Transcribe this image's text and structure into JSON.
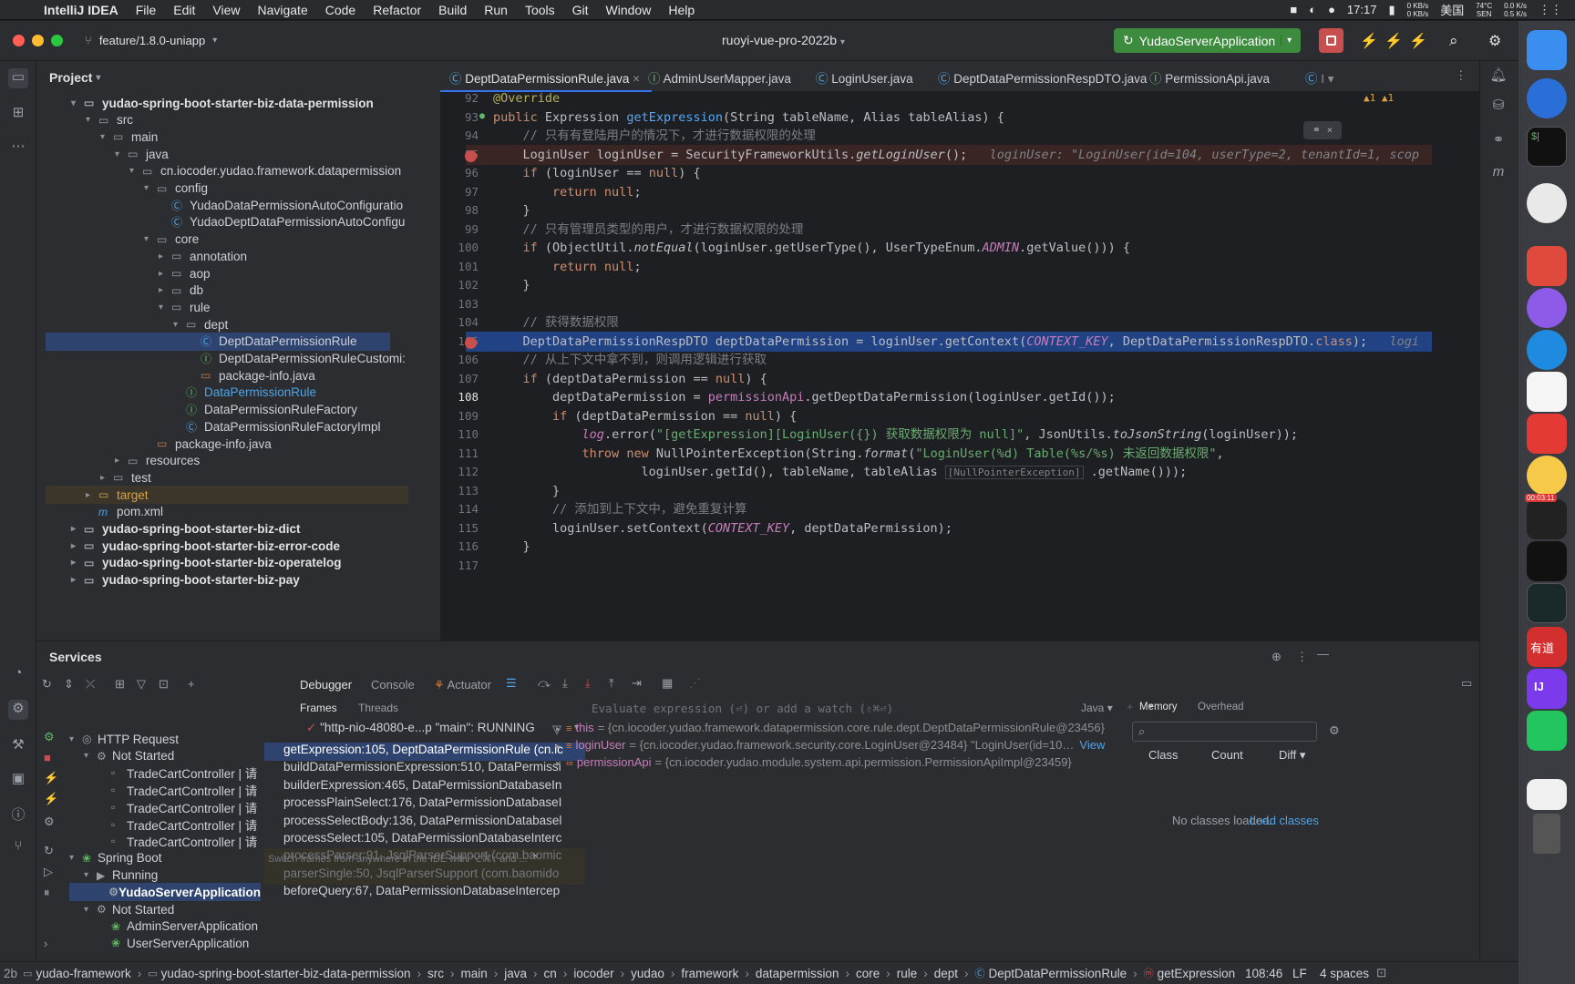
{
  "menubar": {
    "app": "IntelliJ IDEA",
    "items": [
      "File",
      "Edit",
      "View",
      "Navigate",
      "Code",
      "Refactor",
      "Build",
      "Run",
      "Tools",
      "Git",
      "Window",
      "Help"
    ],
    "time": "17:17",
    "net_up": "0 KB/s",
    "net_down": "0 KB/s",
    "input": "美国",
    "temp": "74°C",
    "temp_label": "SEN",
    "net2_up": "0.0 K/s",
    "net2_down": "0.5 K/s"
  },
  "titlebar": {
    "branch": "feature/1.8.0-uniapp",
    "project": "ruoyi-vue-pro-2022b",
    "run_config": "YudaoServerApplication"
  },
  "project": {
    "title": "Project",
    "rows": [
      {
        "label": "yudao-spring-boot-starter-biz-data-permission",
        "depth": 2,
        "arrow": "▾",
        "icon": "folder",
        "bold": true
      },
      {
        "label": "src",
        "depth": 3,
        "arrow": "▾",
        "icon": "folder"
      },
      {
        "label": "main",
        "depth": 4,
        "arrow": "▾",
        "icon": "folder"
      },
      {
        "label": "java",
        "depth": 5,
        "arrow": "▾",
        "icon": "folder"
      },
      {
        "label": "cn.iocoder.yudao.framework.datapermission",
        "depth": 6,
        "arrow": "▾",
        "icon": "folder"
      },
      {
        "label": "config",
        "depth": 7,
        "arrow": "▾",
        "icon": "folder"
      },
      {
        "label": "YudaoDataPermissionAutoConfiguratio",
        "depth": 8,
        "arrow": "",
        "icon": "class"
      },
      {
        "label": "YudaoDeptDataPermissionAutoConfigu",
        "depth": 8,
        "arrow": "",
        "icon": "class"
      },
      {
        "label": "core",
        "depth": 7,
        "arrow": "▾",
        "icon": "folder"
      },
      {
        "label": "annotation",
        "depth": 8,
        "arrow": "▸",
        "icon": "folder"
      },
      {
        "label": "aop",
        "depth": 8,
        "arrow": "▸",
        "icon": "folder"
      },
      {
        "label": "db",
        "depth": 8,
        "arrow": "▸",
        "icon": "folder"
      },
      {
        "label": "rule",
        "depth": 8,
        "arrow": "▾",
        "icon": "folder"
      },
      {
        "label": "dept",
        "depth": 9,
        "arrow": "▾",
        "icon": "folder"
      },
      {
        "label": "DeptDataPermissionRule",
        "depth": 10,
        "arrow": "",
        "icon": "class",
        "selected": true
      },
      {
        "label": "DeptDataPermissionRuleCustomi:",
        "depth": 10,
        "arrow": "",
        "icon": "interface"
      },
      {
        "label": "package-info.java",
        "depth": 10,
        "arrow": "",
        "icon": "file"
      },
      {
        "label": "DataPermissionRule",
        "depth": 9,
        "arrow": "",
        "icon": "interface",
        "blue": true
      },
      {
        "label": "DataPermissionRuleFactory",
        "depth": 9,
        "arrow": "",
        "icon": "interface"
      },
      {
        "label": "DataPermissionRuleFactoryImpl",
        "depth": 9,
        "arrow": "",
        "icon": "class"
      },
      {
        "label": "package-info.java",
        "depth": 7,
        "arrow": "",
        "icon": "file"
      },
      {
        "label": "resources",
        "depth": 5,
        "arrow": "▸",
        "icon": "folder"
      },
      {
        "label": "test",
        "depth": 4,
        "arrow": "▸",
        "icon": "folder"
      },
      {
        "label": "target",
        "depth": 3,
        "arrow": "▸",
        "icon": "folder",
        "target": true
      },
      {
        "label": "pom.xml",
        "depth": 3,
        "arrow": "",
        "icon": "maven"
      },
      {
        "label": "yudao-spring-boot-starter-biz-dict",
        "depth": 2,
        "arrow": "▸",
        "icon": "folder",
        "bold": true
      },
      {
        "label": "yudao-spring-boot-starter-biz-error-code",
        "depth": 2,
        "arrow": "▸",
        "icon": "folder",
        "bold": true
      },
      {
        "label": "yudao-spring-boot-starter-biz-operatelog",
        "depth": 2,
        "arrow": "▸",
        "icon": "folder",
        "bold": true
      },
      {
        "label": "yudao-spring-boot-starter-biz-pay",
        "depth": 2,
        "arrow": "▸",
        "icon": "folder",
        "bold": true
      }
    ]
  },
  "tabs": [
    "DeptDataPermissionRule.java",
    "AdminUserMapper.java",
    "LoginUser.java",
    "DeptDataPermissionRespDTO.java",
    "PermissionApi.java"
  ],
  "editor": {
    "warnings": "▲1  ▲1",
    "lines": [
      {
        "n": "92",
        "html": "<span class='an'>@Override</span>"
      },
      {
        "n": "93",
        "html": "<span class='kw'>public</span> Expression <span class='fn'>getExpression</span>(String tableName, Alias tableAlias) {"
      },
      {
        "n": "94",
        "html": "    <span class='cm'>// 只有有登陆用户的情况下，才进行数据权限的处理</span>"
      },
      {
        "n": "95",
        "html": "    LoginUser loginUser = SecurityFrameworkUtils.<span class='it'>getLoginUser</span>();   <span class='grey it'>loginUser: \"LoginUser(id=104, userType=2, tenantId=1, scop</span>"
      },
      {
        "n": "96",
        "html": "    <span class='kw'>if</span> (loginUser == <span class='kw'>null</span>) {"
      },
      {
        "n": "97",
        "html": "        <span class='kw'>return null</span>;"
      },
      {
        "n": "98",
        "html": "    }"
      },
      {
        "n": "99",
        "html": "    <span class='cm'>// 只有管理员类型的用户，才进行数据权限的处理</span>"
      },
      {
        "n": "100",
        "html": "    <span class='kw'>if</span> (ObjectUtil.<span class='it'>notEqual</span>(loginUser.getUserType(), UserTypeEnum.<span class='cst'>ADMIN</span>.getValue())) {"
      },
      {
        "n": "101",
        "html": "        <span class='kw'>return null</span>;"
      },
      {
        "n": "102",
        "html": "    }"
      },
      {
        "n": "103",
        "html": ""
      },
      {
        "n": "104",
        "html": "    <span class='cm'>// 获得数据权限</span>"
      },
      {
        "n": "105",
        "html": "    DeptDataPermissionRespDTO deptDataPermission = loginUser.getContext(<span class='cst'>CONTEXT_KEY</span>, DeptDataPermissionRespDTO.<span class='kw'>class</span>);   <span class='grey it'>logi</span>"
      },
      {
        "n": "106",
        "html": "    <span class='cm'>// 从上下文中拿不到，则调用逻辑进行获取</span>"
      },
      {
        "n": "107",
        "html": "    <span class='kw'>if</span> (deptDataPermission == <span class='kw'>null</span>) {"
      },
      {
        "n": "108",
        "html": "        deptDataPermission = <span class='fld'>permissionApi</span>.getDeptDataPermission(loginUser.getId());"
      },
      {
        "n": "109",
        "html": "        <span class='kw'>if</span> (deptDataPermission == <span class='kw'>null</span>) {"
      },
      {
        "n": "110",
        "html": "            <span class='fld it'>log</span>.error(<span class='str'>\"[getExpression][LoginUser({}) 获取数据权限为 null]\"</span>, JsonUtils.<span class='it'>toJsonString</span>(loginUser));"
      },
      {
        "n": "111",
        "html": "            <span class='kw'>throw new</span> NullPointerException(String.<span class='it'>format</span>(<span class='str'>\"LoginUser(%d) Table(%s/%s) 未返回数据权限\"</span>,"
      },
      {
        "n": "112",
        "html": "                    loginUser.getId(), tableName, tableAlias <span class='grey' style='font-size:11px;border:1px solid #444;padding:0 2px'>[NullPointerException]</span> .getName()));"
      },
      {
        "n": "113",
        "html": "        }"
      },
      {
        "n": "114",
        "html": "        <span class='cm'>// 添加到上下文中，避免重复计算</span>"
      },
      {
        "n": "115",
        "html": "        loginUser.setContext(<span class='cst'>CONTEXT_KEY</span>, deptDataPermission);"
      },
      {
        "n": "116",
        "html": "    }"
      },
      {
        "n": "117",
        "html": ""
      }
    ]
  },
  "services": {
    "title": "Services",
    "tree": [
      {
        "label": "HTTP Request",
        "depth": 1,
        "arrow": "▾",
        "icon": "◎"
      },
      {
        "label": "Not Started",
        "depth": 2,
        "arrow": "▾",
        "icon": "⚙"
      },
      {
        "label": "TradeCartController  |  请",
        "depth": 3,
        "arrow": "",
        "icon": "▫"
      },
      {
        "label": "TradeCartController  |  请",
        "depth": 3,
        "arrow": "",
        "icon": "▫"
      },
      {
        "label": "TradeCartController  |  请",
        "depth": 3,
        "arrow": "",
        "icon": "▫"
      },
      {
        "label": "TradeCartController  |  请",
        "depth": 3,
        "arrow": "",
        "icon": "▫"
      },
      {
        "label": "TradeCartController  |  请",
        "depth": 3,
        "arrow": "",
        "icon": "▫"
      },
      {
        "label": "Spring Boot",
        "depth": 1,
        "arrow": "▾",
        "icon": "❀"
      },
      {
        "label": "Running",
        "depth": 2,
        "arrow": "▾",
        "icon": "▶"
      },
      {
        "label": "YudaoServerApplication",
        "depth": 3,
        "arrow": "",
        "icon": "⚙",
        "selected": true
      },
      {
        "label": "Not Started",
        "depth": 2,
        "arrow": "▾",
        "icon": "⚙"
      },
      {
        "label": "AdminServerApplication",
        "depth": 3,
        "arrow": "",
        "icon": "❀"
      },
      {
        "label": "UserServerApplication",
        "depth": 3,
        "arrow": "",
        "icon": "❀"
      }
    ],
    "debug_tabs": [
      "Debugger",
      "Console",
      "Actuator"
    ],
    "sub_tabs": [
      "Frames",
      "Threads"
    ],
    "thread": "\"http-nio-48080-e...p \"main\": RUNNING",
    "frames": [
      {
        "label": "getExpression:105, DeptDataPermissionRule (cn.ic",
        "state": "sel"
      },
      {
        "label": "buildDataPermissionExpression:510, DataPermissi",
        "state": ""
      },
      {
        "label": "builderExpression:465, DataPermissionDatabaseIn",
        "state": ""
      },
      {
        "label": "processPlainSelect:176, DataPermissionDatabaseI",
        "state": ""
      },
      {
        "label": "processSelectBody:136, DataPermissionDatabasel",
        "state": ""
      },
      {
        "label": "processSelect:105, DataPermissionDatabaseInterc",
        "state": ""
      },
      {
        "label": "processParser:91, JsqlParserSupport (com.baomic",
        "state": "dim"
      },
      {
        "label": "parserSingle:50, JsqlParserSupport (com.baomido",
        "state": "dim"
      },
      {
        "label": "beforeQuery:67, DataPermissionDatabaseIntercep",
        "state": ""
      }
    ],
    "frames_hint": "Switch frames from anywhere in the IDE with ⌥⌘↑ and ...",
    "eval_placeholder": "Evaluate expression (⏎) or add a watch (⇧⌘⏎)",
    "eval_lang": "Java",
    "vars": [
      {
        "name": "this",
        "value": "= {cn.iocoder.yudao.framework.datapermission.core.rule.dept.DeptDataPermissionRule@23456}"
      },
      {
        "name": "loginUser",
        "value": "= {cn.iocoder.yudao.framework.security.core.LoginUser@23484} \"LoginUser(id=10…",
        "link": "View"
      },
      {
        "name": "permissionApi",
        "value": "= {cn.iocoder.yudao.module.system.api.permission.PermissionApiImpl@23459}"
      }
    ],
    "memory_tabs": [
      "Memory",
      "Overhead"
    ],
    "memory_cols": [
      "Class",
      "Count",
      "Diff"
    ],
    "memory_empty": "No classes loaded.",
    "memory_link": "Load classes"
  },
  "statusbar": {
    "crumbs": [
      "yudao-framework",
      "yudao-spring-boot-starter-biz-data-permission",
      "src",
      "main",
      "java",
      "cn",
      "iocoder",
      "yudao",
      "framework",
      "datapermission",
      "core",
      "rule",
      "dept",
      "DeptDataPermissionRule",
      "getExpression"
    ],
    "position": "108:46",
    "eol": "LF",
    "indent": "4 spaces",
    "prefix": "2b"
  },
  "dock": {
    "badge": "00:03:11"
  }
}
